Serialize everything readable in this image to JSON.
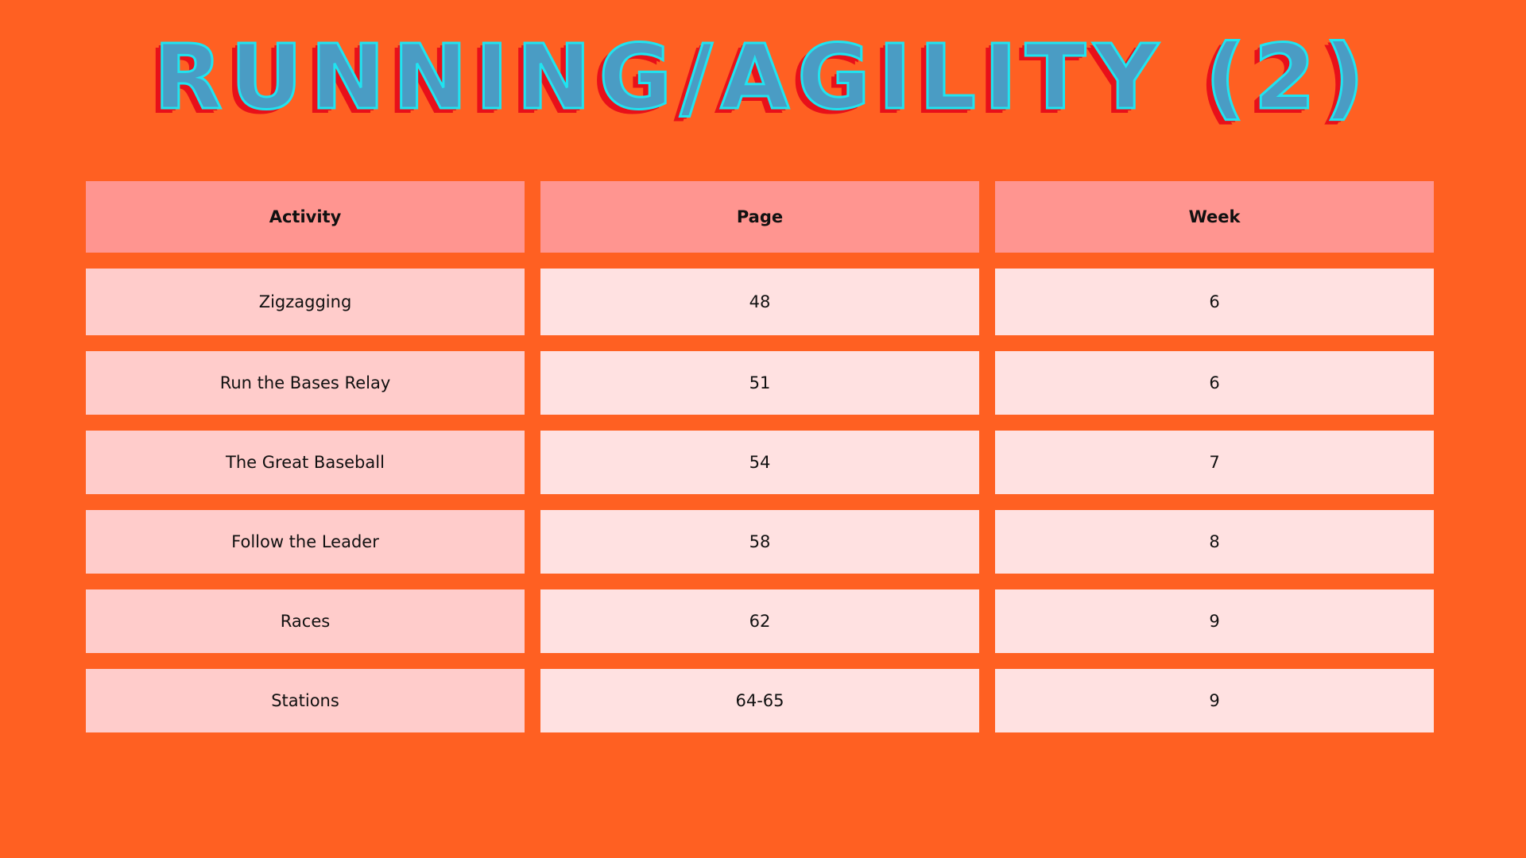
{
  "page": {
    "title": "Running/Agility (2)"
  },
  "colors": {
    "background": "#ff6022",
    "title_fill": "#4a9cc4",
    "title_outline": "#1fe4f0",
    "title_shadow": "#e8101a",
    "header_cell": "#ff9590",
    "activity_cell": "#ffcccb",
    "value_cell": "#ffe1e1"
  },
  "table": {
    "headers": [
      "Activity",
      "Page",
      "Week"
    ],
    "rows": [
      [
        "Zigzagging",
        "48",
        "6"
      ],
      [
        "Run the Bases Relay",
        "51",
        "6"
      ],
      [
        "The Great Baseball",
        "54",
        "7"
      ],
      [
        "Follow the Leader",
        "58",
        "8"
      ],
      [
        "Races",
        "62",
        "9"
      ],
      [
        "Stations",
        "64-65",
        "9"
      ]
    ]
  }
}
